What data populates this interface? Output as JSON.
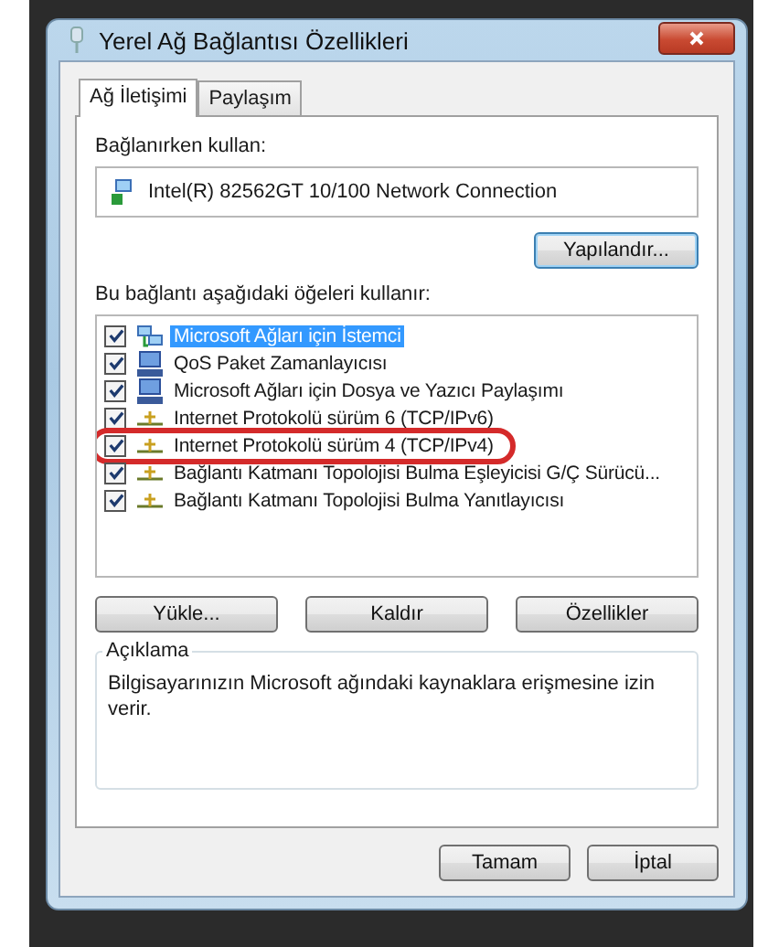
{
  "window": {
    "title": "Yerel Ağ Bağlantısı Özellikleri"
  },
  "tabs": [
    {
      "label": "Ağ İletişimi",
      "selected": true
    },
    {
      "label": "Paylaşım",
      "selected": false
    }
  ],
  "connect_using": {
    "label": "Bağlanırken kullan:",
    "adapter": "Intel(R) 82562GT 10/100 Network Connection"
  },
  "configure_button": "Yapılandır...",
  "items_label": "Bu bağlantı aşağıdaki öğeleri kullanır:",
  "items": [
    {
      "kind": "client",
      "label": "Microsoft Ağları için İstemci",
      "checked": true,
      "selected": true,
      "circled": false
    },
    {
      "kind": "service",
      "label": "QoS Paket Zamanlayıcısı",
      "checked": true,
      "selected": false,
      "circled": false
    },
    {
      "kind": "service",
      "label": "Microsoft Ağları için Dosya ve Yazıcı Paylaşımı",
      "checked": true,
      "selected": false,
      "circled": false
    },
    {
      "kind": "protocol",
      "label": "Internet Protokolü sürüm 6 (TCP/IPv6)",
      "checked": true,
      "selected": false,
      "circled": false
    },
    {
      "kind": "protocol",
      "label": "Internet Protokolü sürüm 4 (TCP/IPv4)",
      "checked": true,
      "selected": false,
      "circled": true
    },
    {
      "kind": "protocol",
      "label": "Bağlantı Katmanı Topolojisi Bulma Eşleyicisi G/Ç Sürücü...",
      "checked": true,
      "selected": false,
      "circled": false
    },
    {
      "kind": "protocol",
      "label": "Bağlantı Katmanı Topolojisi Bulma Yanıtlayıcısı",
      "checked": true,
      "selected": false,
      "circled": false
    }
  ],
  "item_buttons": [
    "Yükle...",
    "Kaldır",
    "Özellikler"
  ],
  "description": {
    "legend": "Açıklama",
    "text": "Bilgisayarınızın Microsoft ağındaki kaynaklara erişmesine izin verir."
  },
  "buttons": [
    "Tamam",
    "İptal"
  ]
}
